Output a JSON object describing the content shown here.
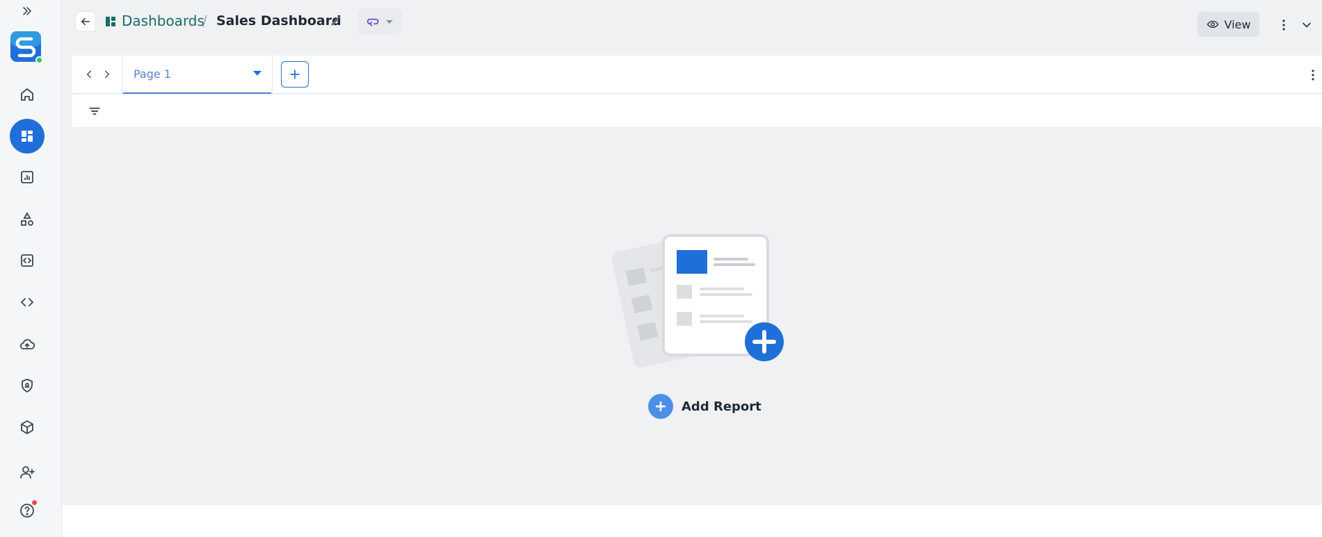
{
  "header": {
    "breadcrumb_link": "Dashboards",
    "breadcrumb_sep": "/",
    "title": "Sales Dashboard",
    "view_label": "View"
  },
  "tabs": {
    "current_page": "Page 1"
  },
  "canvas": {
    "add_report_label": "Add Report"
  },
  "icons": {
    "sidebar": [
      "expand-icon",
      "home-icon",
      "dashboard-icon",
      "reports-icon",
      "shapes-icon",
      "embed-icon",
      "code-icon",
      "cloud-upload-icon",
      "security-icon",
      "package-icon",
      "add-user-icon",
      "help-icon"
    ]
  },
  "colors": {
    "accent": "#1f6fd8",
    "breadcrumb": "#1a6b68",
    "workflow": "#6d3bd7",
    "online": "#34c759",
    "notification": "#e5484d"
  }
}
